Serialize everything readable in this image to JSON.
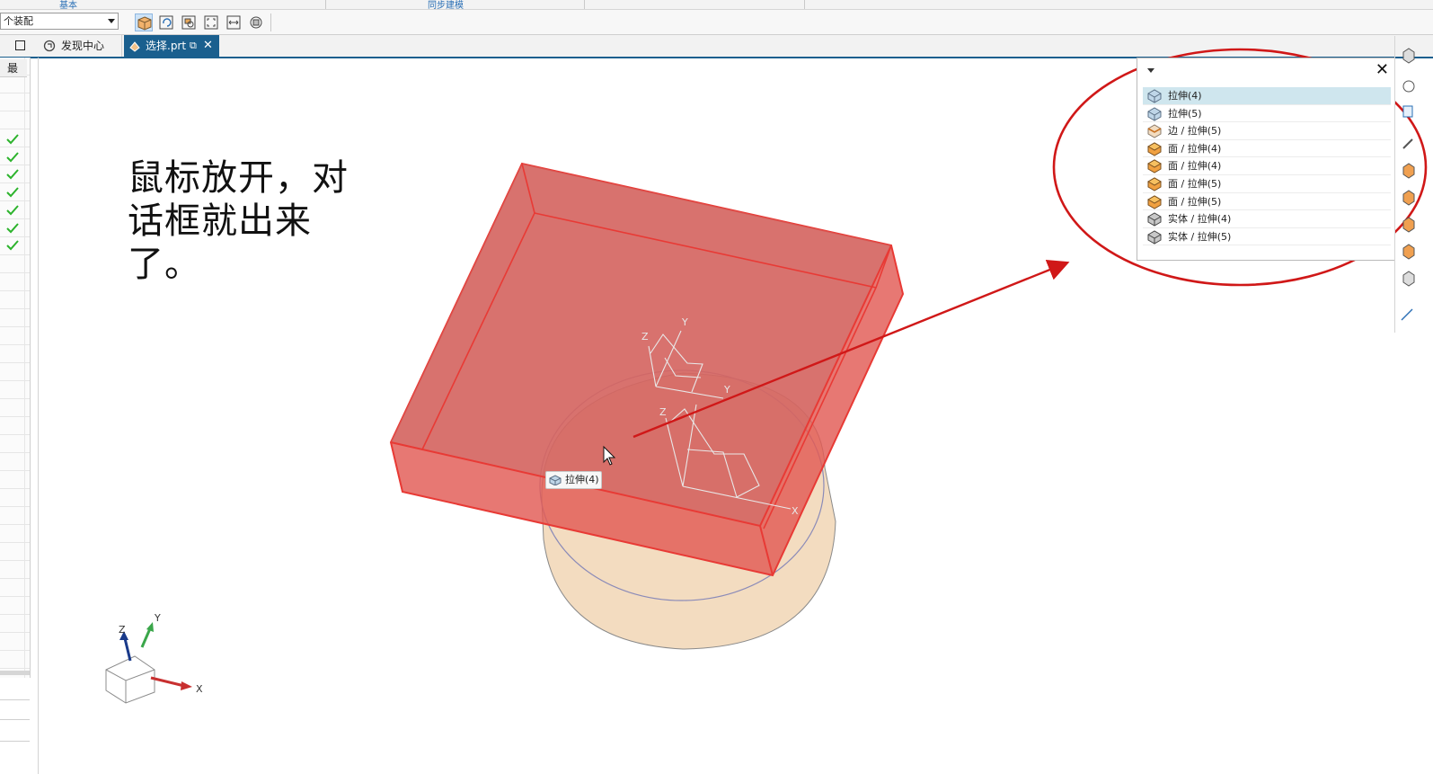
{
  "ribbon": {
    "group_left": "基本",
    "group_right": "同步建模"
  },
  "toolbar": {
    "filter_combo_value": "个装配"
  },
  "tabs": [
    {
      "label": "发现中心",
      "active": false
    },
    {
      "label": "选择.prt",
      "active": true
    }
  ],
  "navigator": {
    "column_header": "最",
    "checked_rows": 7
  },
  "annotation": {
    "text": "鼠标放开，对话框就出来了。"
  },
  "tooltip": {
    "label": "拉伸(4)"
  },
  "quickpick": {
    "items": [
      {
        "label": "拉伸(4)",
        "icon": "extrude-feature-icon",
        "selected": true
      },
      {
        "label": "拉伸(5)",
        "icon": "extrude-feature-icon",
        "selected": false
      },
      {
        "label": "边 / 拉伸(5)",
        "icon": "edge-icon",
        "selected": false
      },
      {
        "label": "面 / 拉伸(4)",
        "icon": "face-icon",
        "selected": false
      },
      {
        "label": "面 / 拉伸(4)",
        "icon": "face-icon",
        "selected": false
      },
      {
        "label": "面 / 拉伸(5)",
        "icon": "face-icon",
        "selected": false
      },
      {
        "label": "面 / 拉伸(5)",
        "icon": "face-icon",
        "selected": false
      },
      {
        "label": "实体 / 拉伸(4)",
        "icon": "solid-body-icon",
        "selected": false
      },
      {
        "label": "实体 / 拉伸(5)",
        "icon": "solid-body-icon",
        "selected": false
      }
    ]
  },
  "axes": {
    "x": "X",
    "y": "Y",
    "z": "Z"
  },
  "colors": {
    "tab_active": "#1a5f8e",
    "box_fill": "#e0605a",
    "box_edge": "#e83a35",
    "cylinder_fill": "#f3dcc0",
    "annotation_red": "#d01818",
    "check_green": "#2cb32c",
    "selected_row": "#cfe6ee"
  }
}
